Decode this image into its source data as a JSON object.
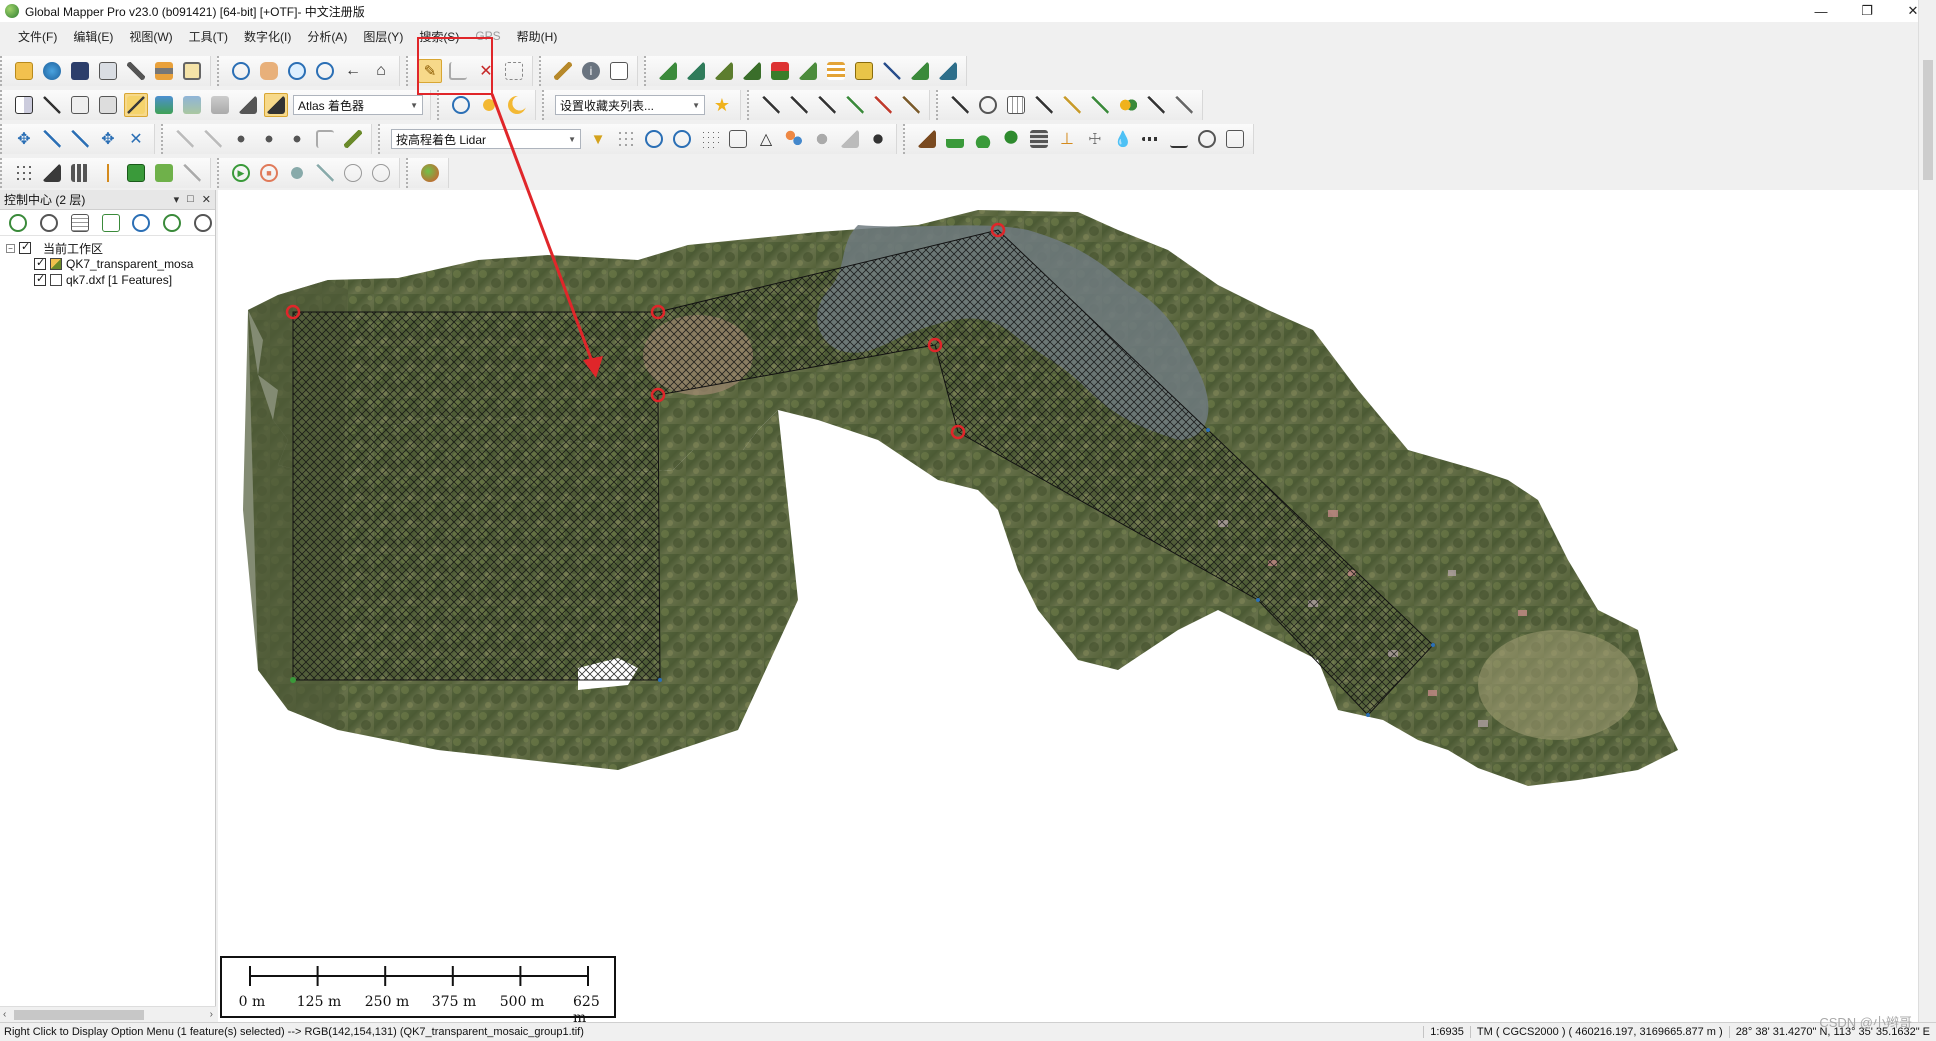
{
  "window": {
    "title": "Global Mapper Pro v23.0 (b091421) [64-bit] [+OTF]- 中文注册版",
    "minimize": "—",
    "restore": "❐",
    "close": "✕"
  },
  "menu": [
    {
      "label": "文件(F)",
      "enabled": true
    },
    {
      "label": "编辑(E)",
      "enabled": true
    },
    {
      "label": "视图(W)",
      "enabled": true
    },
    {
      "label": "工具(T)",
      "enabled": true
    },
    {
      "label": "数字化(I)",
      "enabled": true
    },
    {
      "label": "分析(A)",
      "enabled": true
    },
    {
      "label": "图层(Y)",
      "enabled": true
    },
    {
      "label": "搜索(S)",
      "enabled": true
    },
    {
      "label": "GPS",
      "enabled": false
    },
    {
      "label": "帮助(H)",
      "enabled": true
    }
  ],
  "toolbars": {
    "shader_select": "Atlas 着色器",
    "favorites_select": "设置收藏夹列表...",
    "lidar_select": "按高程着色 Lidar",
    "active_tool": "digitizer-pencil"
  },
  "panel": {
    "title": "控制中心 (2 层)",
    "pin": "▾",
    "float": "□",
    "close": "✕",
    "tree": {
      "root": "当前工作区",
      "layers": [
        {
          "name": "QK7_transparent_mosa"
        },
        {
          "name": "qk7.dxf [1 Features]"
        }
      ]
    }
  },
  "scalebar": {
    "labels": [
      "0 m",
      "125 m",
      "250 m",
      "375 m",
      "500 m",
      "625 m"
    ]
  },
  "status": {
    "message": "Right Click to Display Option Menu (1 feature(s) selected) --> RGB(142,154,131) (QK7_transparent_mosaic_group1.tif)",
    "scale": "1:6935",
    "projection": "TM ( CGCS2000 ) ( 460216.197, 3169665.877 m )",
    "latlon": "28° 38' 31.4270\" N, 113° 35' 35.1632\" E"
  },
  "watermark": "CSDN @小辫哥",
  "colors": {
    "highlight_box": "#e0262a",
    "arrow": "#e0262a",
    "vertex_ring": "#e0262a",
    "hatch": "#111111"
  }
}
